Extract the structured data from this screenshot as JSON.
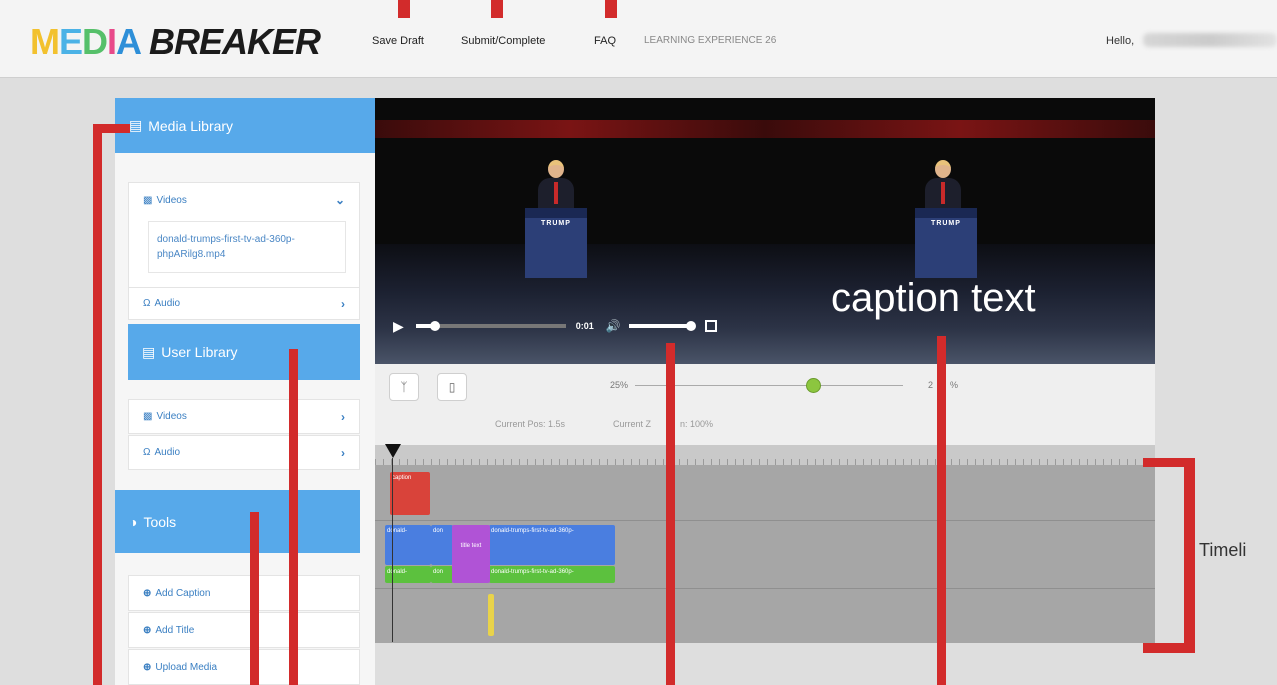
{
  "app": {
    "logo_part1": "MEDIA",
    "logo_part2": "BREAKER",
    "nav": {
      "save_draft": "Save Draft",
      "submit": "Submit/Complete",
      "faq": "FAQ",
      "experience": "LEARNING EXPERIENCE 26"
    },
    "user": {
      "greeting": "Hello,"
    }
  },
  "sidebar": {
    "media_library": {
      "title": "Media Library",
      "videos_label": "Videos",
      "video_file": "donald-trumps-first-tv-ad-360p-phpARilg8.mp4",
      "audio_label": "Audio"
    },
    "user_library": {
      "title": "User Library",
      "videos_label": "Videos",
      "audio_label": "Audio"
    },
    "tools": {
      "title": "Tools",
      "items": [
        "Add Caption",
        "Add Title",
        "Upload Media"
      ]
    }
  },
  "player": {
    "time": "0:01",
    "progress": 0.13,
    "volume": 1.0,
    "podium_text": "TRUMP"
  },
  "preview": {
    "caption": "caption text"
  },
  "toolbar": {
    "zoom_min": "25%",
    "zoom_max": "2",
    "zoom_max_suffix": "%",
    "zoom_level": 0.7,
    "current_pos": "Current Pos: 1.5s",
    "current_zoom": "Current Z",
    "current_zoom_suffix": "n: 100%"
  },
  "timeline": {
    "label": "Timeli",
    "caption_clip": "caption",
    "title_clip": "title text",
    "video_clips": [
      "donald-",
      "don",
      "donald-trumps-first-tv-ad-360p-"
    ],
    "audio_clips": [
      "donald-",
      "don",
      "donald-trumps-first-tv-ad-360p-"
    ]
  },
  "colors": {
    "panel_blue": "#57a9ea",
    "marker_red": "#d22b2b",
    "caption_clip": "#d9433a",
    "title_clip": "#b053d6",
    "video_clip": "#4a7ee0",
    "audio_clip": "#5cc13e",
    "slider_knob": "#8cc63f"
  },
  "icons": {
    "media_library": "film-icon",
    "videos": "video-camera-icon",
    "audio": "headphones-icon",
    "tools": "half-circle-icon",
    "tool_item": "plus-circle-icon",
    "trim": "scissors-fork-icon",
    "delete": "trash-icon"
  }
}
